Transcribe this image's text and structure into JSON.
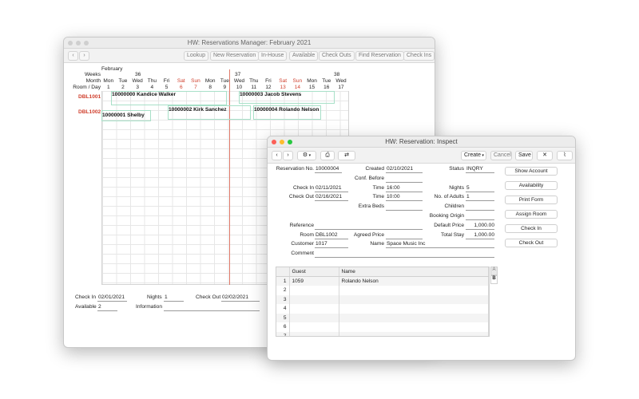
{
  "manager": {
    "title": "HW: Reservations Manager: February 2021",
    "toolbar": [
      "Lookup",
      "New Reservation",
      "In-House",
      "Available",
      "Check Outs",
      "Find Reservation",
      "Check Ins"
    ],
    "header_labels": {
      "weeks": "Weeks",
      "month": "Month",
      "room_day": "Room / Day",
      "month_name": "February"
    },
    "weeks": [
      "36",
      "37",
      "38"
    ],
    "days": [
      {
        "dow": "Mon",
        "num": "1",
        "weekend": false
      },
      {
        "dow": "Tue",
        "num": "2",
        "weekend": false
      },
      {
        "dow": "Wed",
        "num": "3",
        "weekend": false
      },
      {
        "dow": "Thu",
        "num": "4",
        "weekend": false
      },
      {
        "dow": "Fri",
        "num": "5",
        "weekend": false
      },
      {
        "dow": "Sat",
        "num": "6",
        "weekend": true
      },
      {
        "dow": "Sun",
        "num": "7",
        "weekend": true
      },
      {
        "dow": "Mon",
        "num": "8",
        "weekend": false
      },
      {
        "dow": "Tue",
        "num": "9",
        "weekend": false
      },
      {
        "dow": "Wed",
        "num": "10",
        "weekend": false
      },
      {
        "dow": "Thu",
        "num": "11",
        "weekend": false
      },
      {
        "dow": "Fri",
        "num": "12",
        "weekend": false
      },
      {
        "dow": "Sat",
        "num": "13",
        "weekend": true
      },
      {
        "dow": "Sun",
        "num": "14",
        "weekend": true
      },
      {
        "dow": "Mon",
        "num": "15",
        "weekend": false
      },
      {
        "dow": "Tue",
        "num": "16",
        "weekend": false
      },
      {
        "dow": "Wed",
        "num": "17",
        "weekend": false
      }
    ],
    "rooms": [
      "DBL1001",
      "DBL1002"
    ],
    "reservations": [
      "10000000 Kandice Walker",
      "10000003 Jacob Stevens",
      "10000002 Kirk Sanchez",
      "10000004 Rolando Nelson",
      "10000001 Shelby"
    ],
    "footer": {
      "check_in_label": "Check In",
      "check_in": "02/01/2021",
      "nights_label": "Nights",
      "nights": "1",
      "check_out_label": "Check Out",
      "check_out": "02/02/2021",
      "available_label": "Available",
      "available": "2",
      "information_label": "Information"
    }
  },
  "inspect": {
    "title": "HW: Reservation: Inspect",
    "toolbar": {
      "create": "Create",
      "cancel": "Cancel",
      "save": "Save"
    },
    "fields": {
      "reservation_no_label": "Reservation No.",
      "reservation_no": "10000004",
      "created_label": "Created",
      "created": "02/10/2021",
      "status_label": "Status",
      "status": "INQRY",
      "conf_before_label": "Conf. Before",
      "check_in_label": "Check In",
      "check_in": "02/11/2021",
      "time_label": "Time",
      "check_in_time": "16:00",
      "nights_label": "Nights",
      "nights": "5",
      "check_out_label": "Check Out",
      "check_out": "02/16/2021",
      "check_out_time": "10:00",
      "adults_label": "No. of Adults",
      "adults": "1",
      "extra_beds_label": "Extra Beds",
      "children_label": "Children",
      "booking_origin_label": "Booking Origin",
      "reference_label": "Reference",
      "default_price_label": "Default Price",
      "default_price": "1,000.00",
      "room_label": "Room",
      "room": "DBL1002",
      "agreed_price_label": "Agreed Price",
      "total_stay_label": "Total Stay",
      "total_stay": "1,000.00",
      "customer_label": "Customer",
      "customer": "1017",
      "name_label": "Name",
      "name": "Space Music Inc",
      "comment_label": "Comment"
    },
    "side_buttons": [
      "Show Account",
      "Availability",
      "Print Form",
      "Assign Room",
      "Check In",
      "Check Out"
    ],
    "guests_table": {
      "headers": [
        "Guest",
        "Name"
      ],
      "rows": [
        {
          "n": "1",
          "guest": "1059",
          "name": "Rolando Nelson"
        },
        {
          "n": "2",
          "guest": "",
          "name": ""
        },
        {
          "n": "3",
          "guest": "",
          "name": ""
        },
        {
          "n": "4",
          "guest": "",
          "name": ""
        },
        {
          "n": "5",
          "guest": "",
          "name": ""
        },
        {
          "n": "6",
          "guest": "",
          "name": ""
        },
        {
          "n": "7",
          "guest": "",
          "name": ""
        }
      ],
      "side_labels": [
        "A",
        "B"
      ]
    }
  },
  "colors": {
    "weekend": "#d0402e",
    "room": "#d0402e",
    "today_line": "#e07a6a",
    "traffic_close": "#fc5f57",
    "traffic_min": "#fdbc2e",
    "traffic_max": "#28c840"
  }
}
